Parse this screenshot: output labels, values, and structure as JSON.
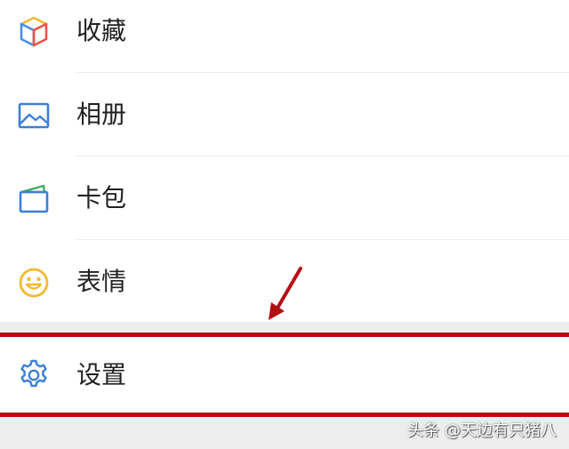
{
  "menu": {
    "items": [
      {
        "label": "收藏",
        "icon": "favorites-cube-icon"
      },
      {
        "label": "相册",
        "icon": "photo-album-icon"
      },
      {
        "label": "卡包",
        "icon": "card-wallet-icon"
      },
      {
        "label": "表情",
        "icon": "smiley-face-icon"
      }
    ],
    "settings": {
      "label": "设置",
      "icon": "gear-icon"
    }
  },
  "watermark": "头条 @天边有只猪八",
  "colors": {
    "highlight_red": "#b40f14",
    "gap_gray": "#ededed",
    "icon_blue": "#3b7fd9",
    "icon_yellow": "#f5b92e"
  }
}
